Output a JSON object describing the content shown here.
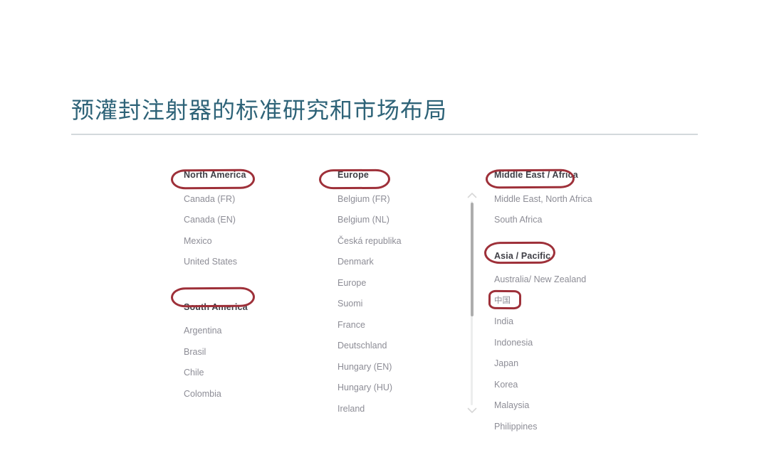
{
  "slide": {
    "title": "预灌封注射器的标准研究和市场布局",
    "title_color": "#2e6378",
    "background_color": "#ffffff",
    "rule_color": "#d3d9dc"
  },
  "annotation": {
    "color": "#9e3039",
    "style": "hand-drawn red rounded rectangle",
    "targets": [
      "North America",
      "South America",
      "Europe",
      "Middle East / Africa",
      "Asia / Pacific",
      "中国"
    ]
  },
  "picker": {
    "columns": [
      {
        "name": "column-americas",
        "groups": [
          {
            "heading": "North America",
            "highlighted": true,
            "locales": [
              "Canada (FR)",
              "Canada (EN)",
              "Mexico",
              "United States"
            ]
          },
          {
            "heading": "South America",
            "highlighted": true,
            "locales": [
              "Argentina",
              "Brasil",
              "Chile",
              "Colombia"
            ]
          }
        ]
      },
      {
        "name": "column-europe",
        "groups": [
          {
            "heading": "Europe",
            "highlighted": true,
            "locales": [
              "Belgium (FR)",
              "Belgium (NL)",
              "Česká republika",
              "Denmark",
              "Europe",
              "Suomi",
              "France",
              "Deutschland",
              "Hungary (EN)",
              "Hungary (HU)",
              "Ireland"
            ]
          }
        ]
      },
      {
        "name": "column-apac-mea",
        "groups": [
          {
            "heading": "Middle East / Africa",
            "highlighted": true,
            "locales": [
              "Middle East, North Africa",
              "South Africa"
            ]
          },
          {
            "heading": "Asia / Pacific",
            "highlighted": true,
            "locales": [
              "Australia/ New Zealand",
              "中国",
              "India",
              "Indonesia",
              "Japan",
              "Korea",
              "Malaysia",
              "Philippines"
            ]
          }
        ]
      }
    ],
    "scrollbar": {
      "up_arrow": "chevron-up",
      "down_arrow": "chevron-down",
      "track_color": "#eceded",
      "thumb_color": "#adadad"
    }
  }
}
